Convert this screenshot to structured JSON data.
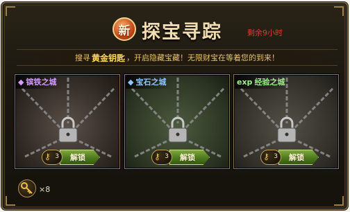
{
  "header": {
    "badge": "新",
    "title": "探宝寻踪",
    "timer": "剩余9小时"
  },
  "banner": {
    "prefix": "搜寻",
    "highlight": "黄金钥匙",
    "suffix": "，开启隐藏宝藏！无限财宝在等着您的到来！"
  },
  "cards": [
    {
      "label": "镔铁之城",
      "icon": "purple-gem-icon",
      "key_count": "3",
      "button": "解锁",
      "accent": "#d49cff"
    },
    {
      "label": "宝石之城",
      "icon": "blue-gem-icon",
      "key_count": "3",
      "button": "解锁",
      "accent": "#8fc6ff"
    },
    {
      "label": "经验之城",
      "icon": "exp-icon",
      "icon_text": "exp",
      "key_count": "3",
      "button": "解锁",
      "accent": "#9ef08c"
    }
  ],
  "footer": {
    "key_count": "×8"
  },
  "colors": {
    "gold": "#ffd85a",
    "timer_red": "#e03a2a",
    "button_green": "#4d7a1e"
  }
}
